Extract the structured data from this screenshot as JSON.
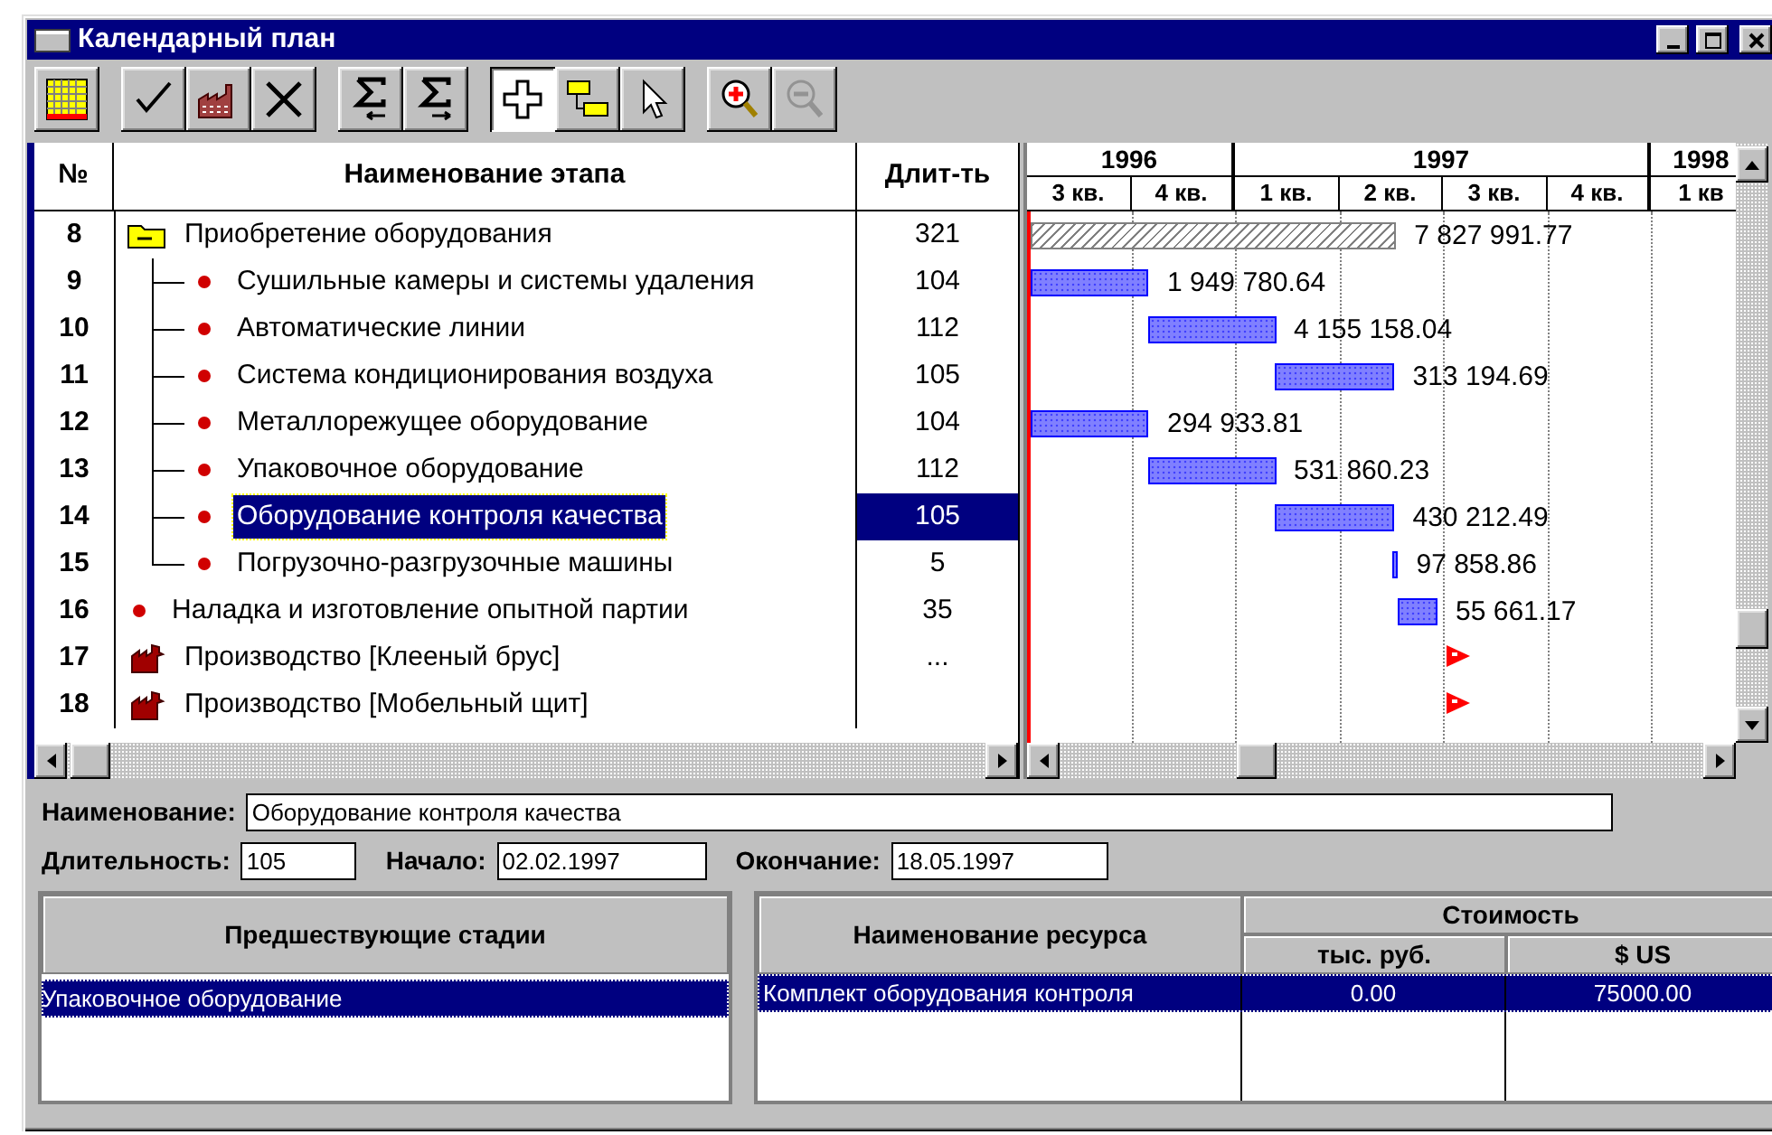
{
  "window": {
    "title": "Календарный план"
  },
  "toolbar": {
    "groups": [
      {
        "buttons": [
          {
            "kind": "calendar",
            "pressed": false,
            "disabled": false
          }
        ]
      },
      {
        "buttons": [
          {
            "kind": "check",
            "pressed": false,
            "disabled": false
          },
          {
            "kind": "factory",
            "pressed": false,
            "disabled": false
          },
          {
            "kind": "delete",
            "pressed": false,
            "disabled": false
          }
        ]
      },
      {
        "buttons": [
          {
            "kind": "sum-left",
            "pressed": false,
            "disabled": false
          },
          {
            "kind": "sum-right",
            "pressed": false,
            "disabled": false
          }
        ]
      },
      {
        "buttons": [
          {
            "kind": "add",
            "pressed": true,
            "disabled": false
          },
          {
            "kind": "link",
            "pressed": false,
            "disabled": false
          },
          {
            "kind": "pointer",
            "pressed": false,
            "disabled": false
          }
        ]
      },
      {
        "buttons": [
          {
            "kind": "zoom-in",
            "pressed": false,
            "disabled": false
          },
          {
            "kind": "zoom-out",
            "pressed": false,
            "disabled": true
          }
        ]
      }
    ]
  },
  "table": {
    "columns": [
      "№",
      "Наименование этапа",
      "Длит-ть"
    ],
    "rows": [
      {
        "number": "8",
        "name": "Приобретение оборудования",
        "duration": "321",
        "kind": "folder",
        "expanded": true,
        "selected": false,
        "bar": {
          "kind": "summary",
          "amount": "7 827 991.77"
        },
        "children": [
          {
            "number": "9",
            "name": "Сушильные камеры и системы удаления",
            "duration": "104",
            "kind": "task",
            "selected": false,
            "bar": {
              "kind": "task",
              "amount": "1 949 780.64"
            }
          },
          {
            "number": "10",
            "name": "Автоматические линии",
            "duration": "112",
            "kind": "task",
            "selected": false,
            "bar": {
              "kind": "task",
              "amount": "4 155 158.04"
            }
          },
          {
            "number": "11",
            "name": "Система кондиционирования воздуха",
            "duration": "105",
            "kind": "task",
            "selected": false,
            "bar": {
              "kind": "task",
              "amount": "313 194.69"
            }
          },
          {
            "number": "12",
            "name": "Металлорежущее оборудование",
            "duration": "104",
            "kind": "task",
            "selected": false,
            "bar": {
              "kind": "task",
              "amount": "294 933.81"
            }
          },
          {
            "number": "13",
            "name": "Упаковочное оборудование",
            "duration": "112",
            "kind": "task",
            "selected": false,
            "bar": {
              "kind": "task",
              "amount": "531 860.23"
            }
          },
          {
            "number": "14",
            "name": "Оборудование контроля качества",
            "duration": "105",
            "kind": "task",
            "selected": true,
            "bar": {
              "kind": "task",
              "amount": "430 212.49"
            }
          },
          {
            "number": "15",
            "name": "Погрузочно-разгрузочные машины",
            "duration": "5",
            "kind": "task",
            "selected": false,
            "bar": {
              "kind": "task",
              "amount": "97 858.86"
            }
          }
        ]
      },
      {
        "number": "16",
        "name": "Наладка и изготовление опытной партии",
        "duration": "35",
        "kind": "task",
        "selected": false,
        "bar": {
          "kind": "task",
          "amount": "55 661.17"
        }
      },
      {
        "number": "17",
        "name": "Производство [Клееный брус]",
        "duration": "...",
        "kind": "production",
        "selected": false,
        "bar": {
          "kind": "flag"
        }
      },
      {
        "number": "18",
        "name": "Производство [Мобельный щит]",
        "kind": "production",
        "selected": false,
        "bar": {
          "kind": "flag"
        }
      }
    ]
  },
  "gantt": {
    "years": [
      {
        "label": "1996",
        "quarters": [
          "3 кв.",
          "4 кв."
        ]
      },
      {
        "label": "1997",
        "quarters": [
          "1 кв.",
          "2 кв.",
          "3 кв.",
          "4 кв."
        ]
      },
      {
        "label": "1998",
        "quarters": [
          "1 кв"
        ]
      }
    ]
  },
  "details": {
    "lines": [
      {
        "fields": [
          {
            "label": "Наименование:",
            "value": "Оборудование контроля качества"
          }
        ]
      },
      {
        "fields": [
          {
            "label": "Длительность:",
            "value": "105"
          },
          {
            "label": "Начало:",
            "value": "02.02.1997"
          },
          {
            "label": "Окончание:",
            "value": "18.05.1997"
          }
        ]
      }
    ]
  },
  "predecessors": {
    "column": "Предшествующие стадии",
    "rows": [
      {
        "name": "Упаковочное оборудование",
        "selected": true
      }
    ]
  },
  "resources": {
    "name_column": "Наименование ресурса",
    "cost_header": "Стоимость",
    "cost_columns": [
      "тыс. руб.",
      "$ US"
    ],
    "rows": [
      {
        "name": "Комплект оборудования контроля",
        "rub": "0.00",
        "usd": "75000.00",
        "selected": true
      }
    ]
  }
}
